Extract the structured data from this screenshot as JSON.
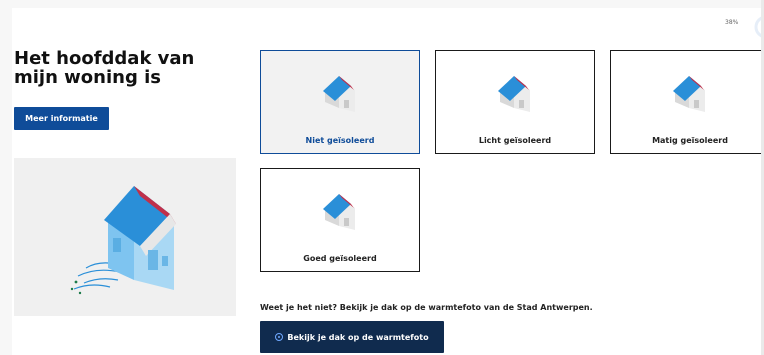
{
  "progress": {
    "label": "38%",
    "value": 0.38
  },
  "question": {
    "title": "Het hoofddak van mijn woning is",
    "info_button": "Meer informatie"
  },
  "options": [
    {
      "label": "Niet geïsoleerd",
      "selected": true
    },
    {
      "label": "Licht geïsoleerd",
      "selected": false
    },
    {
      "label": "Matig geïsoleerd",
      "selected": false
    },
    {
      "label": "Goed geïsoleerd",
      "selected": false
    }
  ],
  "help": {
    "text": "Weet je het niet? Bekijk je dak op de warmtefoto van de Stad Antwerpen.",
    "button": "Bekijk je dak op de warmtefoto"
  },
  "colors": {
    "primary": "#0f4c99",
    "dark_button": "#102b4e",
    "roof_blue": "#2a8fd8",
    "roof_red": "#c0304a"
  }
}
